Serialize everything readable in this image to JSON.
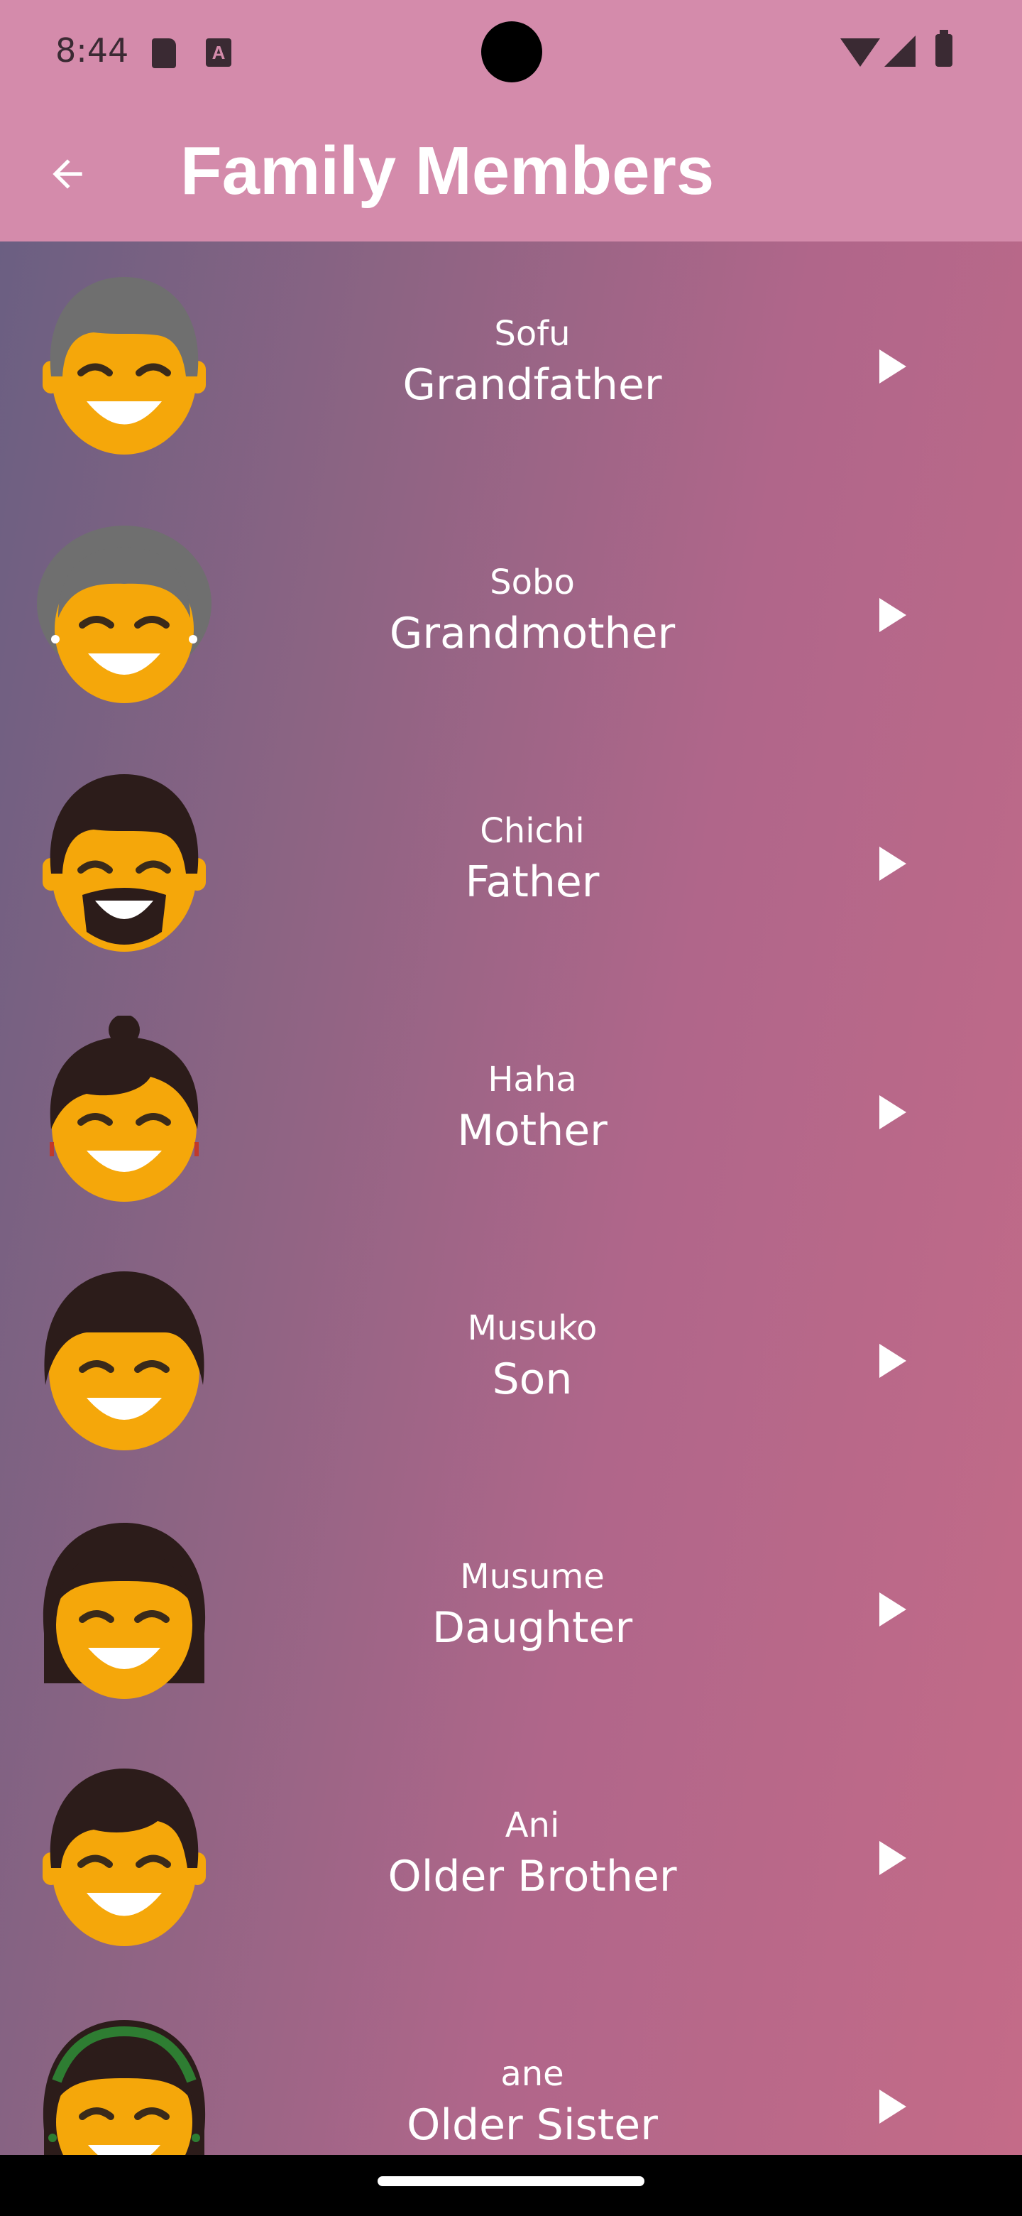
{
  "status_bar": {
    "time": "8:44",
    "icons": [
      "sd-card-icon",
      "a-notification-icon",
      "wifi-icon",
      "signal-icon",
      "battery-icon"
    ]
  },
  "app_bar": {
    "title": "Family Members",
    "back_icon": "arrow-left-icon",
    "color": "#d48bab"
  },
  "members": [
    {
      "romaji": "Sofu",
      "english": "Grandfather",
      "avatar": "grandfather-icon"
    },
    {
      "romaji": "Sobo",
      "english": "Grandmother",
      "avatar": "grandmother-icon"
    },
    {
      "romaji": "Chichi",
      "english": "Father",
      "avatar": "father-icon"
    },
    {
      "romaji": "Haha",
      "english": "Mother",
      "avatar": "mother-icon"
    },
    {
      "romaji": "Musuko",
      "english": "Son",
      "avatar": "son-icon"
    },
    {
      "romaji": "Musume",
      "english": "Daughter",
      "avatar": "daughter-icon"
    },
    {
      "romaji": "Ani",
      "english": "Older Brother",
      "avatar": "older-brother-icon"
    },
    {
      "romaji": "ane",
      "english": "Older Sister",
      "avatar": "older-sister-icon"
    }
  ],
  "colors": {
    "face": "#f5a70a",
    "gray_hair": "#6f6f6f",
    "dark_hair": "#2c1c1a",
    "headband": "#2e7d32",
    "play": "#ffffff"
  }
}
